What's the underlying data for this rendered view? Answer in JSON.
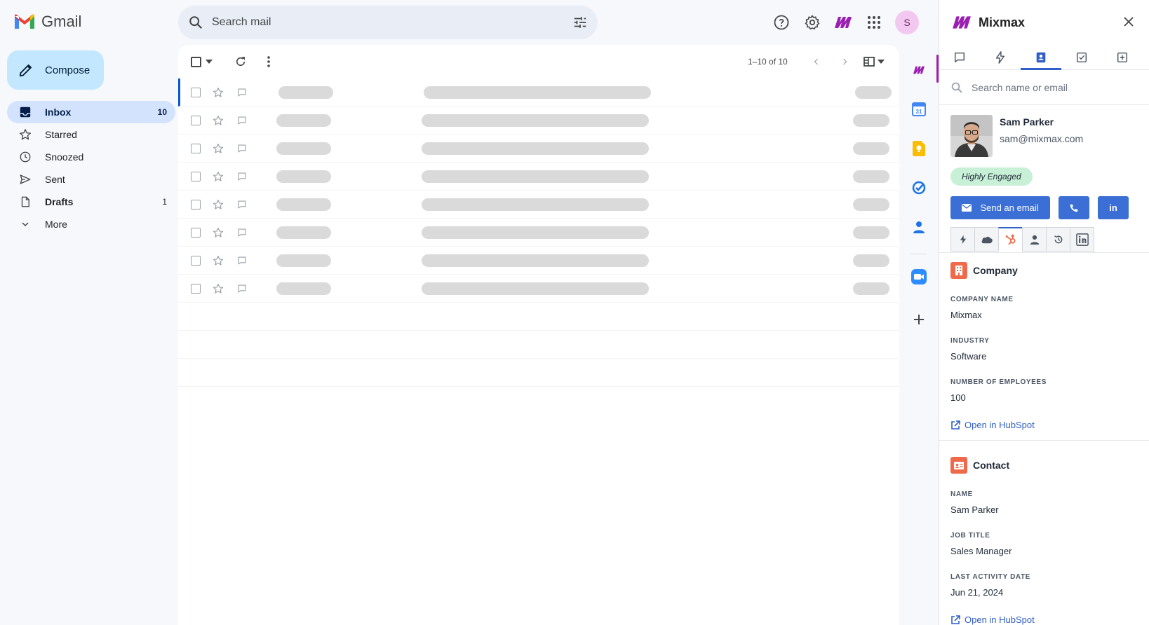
{
  "app": {
    "name": "Gmail"
  },
  "compose": {
    "label": "Compose"
  },
  "nav": [
    {
      "label": "Inbox",
      "count": "10",
      "icon": "inbox-icon"
    },
    {
      "label": "Starred",
      "count": "",
      "icon": "star-icon"
    },
    {
      "label": "Snoozed",
      "count": "",
      "icon": "clock-icon"
    },
    {
      "label": "Sent",
      "count": "",
      "icon": "send-icon"
    },
    {
      "label": "Drafts",
      "count": "1",
      "icon": "draft-icon"
    },
    {
      "label": "More",
      "count": "",
      "icon": "chevron-down-icon"
    }
  ],
  "search": {
    "placeholder": "Search mail"
  },
  "list": {
    "pager": "1–10 of 10",
    "loading_rows": 8
  },
  "mixmax": {
    "title": "Mixmax",
    "search_placeholder": "Search name or email",
    "contact": {
      "name": "Sam Parker",
      "email": "sam@mixmax.com",
      "badge": "Highly Engaged"
    },
    "send_label": "Send an email",
    "linkedin_label": "in",
    "company": {
      "heading": "Company",
      "fields": [
        {
          "label": "COMPANY NAME",
          "value": "Mixmax"
        },
        {
          "label": "INDUSTRY",
          "value": "Software"
        },
        {
          "label": "NUMBER OF EMPLOYEES",
          "value": "100"
        }
      ],
      "link": "Open in HubSpot"
    },
    "contact_section": {
      "heading": "Contact",
      "fields": [
        {
          "label": "NAME",
          "value": "Sam Parker"
        },
        {
          "label": "JOB TITLE",
          "value": "Sales Manager"
        },
        {
          "label": "LAST ACTIVITY DATE",
          "value": "Jun 21, 2024"
        }
      ],
      "link": "Open in HubSpot"
    }
  },
  "colors": {
    "accent": "#3b6fd6",
    "hubspot": "#ef6a4b",
    "badge": "#c8f0d7",
    "mixmax": "#a21caf"
  }
}
